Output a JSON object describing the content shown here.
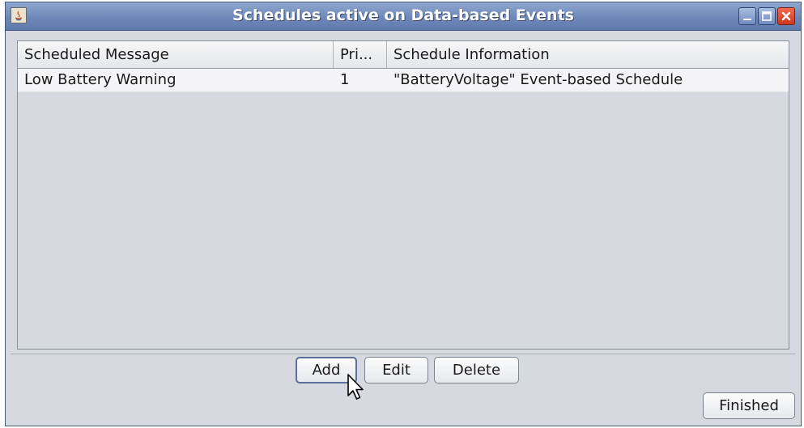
{
  "window": {
    "title": "Schedules active on Data-based Events",
    "icon": "java-icon",
    "controls": [
      "minimize-icon",
      "maximize-icon",
      "close-icon"
    ]
  },
  "table": {
    "columns": [
      "Scheduled Message",
      "Pri...",
      "Schedule Information"
    ],
    "rows": [
      [
        "Low Battery Warning",
        "1",
        "\"BatteryVoltage\" Event-based Schedule"
      ]
    ]
  },
  "buttons": {
    "add": "Add",
    "edit": "Edit",
    "delete": "Delete",
    "finished": "Finished"
  },
  "colors": {
    "titlebar": "#6e89b9",
    "close_button": "#d0361c",
    "panel_background": "#d6d9df"
  }
}
